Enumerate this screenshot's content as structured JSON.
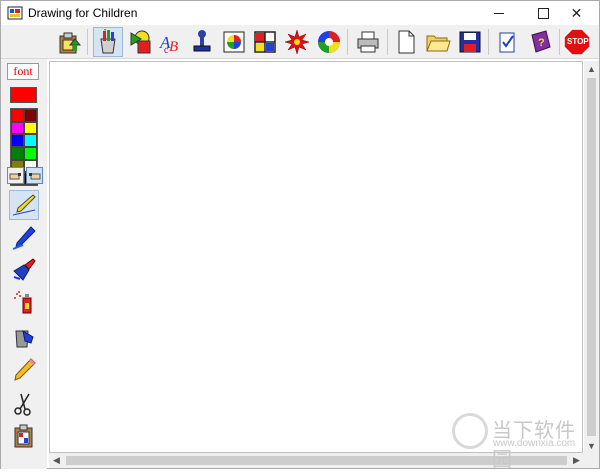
{
  "window": {
    "title": "Drawing for Children",
    "controls": {
      "minimize": "minimize",
      "maximize": "maximize",
      "close": "✕"
    }
  },
  "toolbar": {
    "buttons": [
      {
        "name": "clipboard-upload-icon",
        "active": false
      },
      {
        "name": "paint-can-icon",
        "active": true
      },
      {
        "name": "shapes-icon",
        "active": false
      },
      {
        "name": "text-abc-icon",
        "active": false
      },
      {
        "name": "stamp-icon",
        "active": false
      },
      {
        "name": "pie-picture-icon",
        "active": false
      },
      {
        "name": "mondrian-grid-icon",
        "active": false
      },
      {
        "name": "red-star-icon",
        "active": false
      },
      {
        "name": "spiral-wheel-icon",
        "active": false
      },
      {
        "name": "printer-icon",
        "active": false
      },
      {
        "name": "new-file-icon",
        "active": false
      },
      {
        "name": "open-folder-icon",
        "active": false
      },
      {
        "name": "save-disk-icon",
        "active": false
      },
      {
        "name": "checklist-icon",
        "active": false
      },
      {
        "name": "help-book-icon",
        "active": false
      },
      {
        "name": "stop-icon",
        "active": false
      }
    ],
    "stop_label": "STOP"
  },
  "left_panel": {
    "font_label": "font",
    "current_color": "#ff0000",
    "palette": [
      "#ff0000",
      "#800000",
      "#ff00ff",
      "#ffff00",
      "#0000ff",
      "#00ffff",
      "#008000",
      "#00ff00",
      "#808000",
      "#ffffff",
      "#c0c0c0",
      "#000000"
    ],
    "modes": [
      {
        "name": "hand-left-icon",
        "selected": false
      },
      {
        "name": "hand-right-icon",
        "selected": true
      }
    ],
    "tools": [
      {
        "name": "pen-nib-icon",
        "active": true
      },
      {
        "name": "pencil-blue-icon",
        "active": false
      },
      {
        "name": "brush-icon",
        "active": false
      },
      {
        "name": "spray-can-icon",
        "active": false
      },
      {
        "name": "paint-bucket-icon",
        "active": false
      },
      {
        "name": "eraser-pencil-icon",
        "active": false
      },
      {
        "name": "scissors-icon",
        "active": false
      },
      {
        "name": "picture-clipboard-icon",
        "active": false
      }
    ]
  },
  "watermark": {
    "main": "当下软件园",
    "sub": "www.downxia.com"
  }
}
